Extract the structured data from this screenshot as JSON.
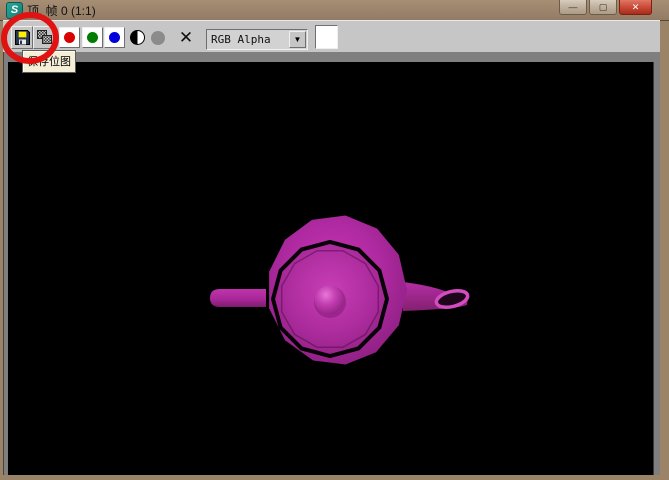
{
  "window": {
    "title": "顶, 帧 0 (1:1)",
    "app_icon_glyph": "S",
    "minimize_glyph": "—",
    "maximize_glyph": "▢",
    "close_glyph": "✕"
  },
  "toolbar": {
    "save_tooltip": "保存位图",
    "channel_select_value": "RGB Alpha",
    "clear_channels_glyph": "✕",
    "dropdown_arrow_glyph": "▼",
    "background_swatch_color": "#ffffff"
  },
  "colors": {
    "titlebar_tan": "#9b8368",
    "toolbar_gray": "#c6c6c6",
    "frame_gray": "#7f7f7f",
    "canvas_black": "#000000",
    "teapot_magenta": "#b82aa6",
    "teapot_highlight": "#dc6ad0",
    "teapot_shadow": "#8a1c7c",
    "annotation_red": "#e01212",
    "close_button_red": "#c23b2e"
  }
}
